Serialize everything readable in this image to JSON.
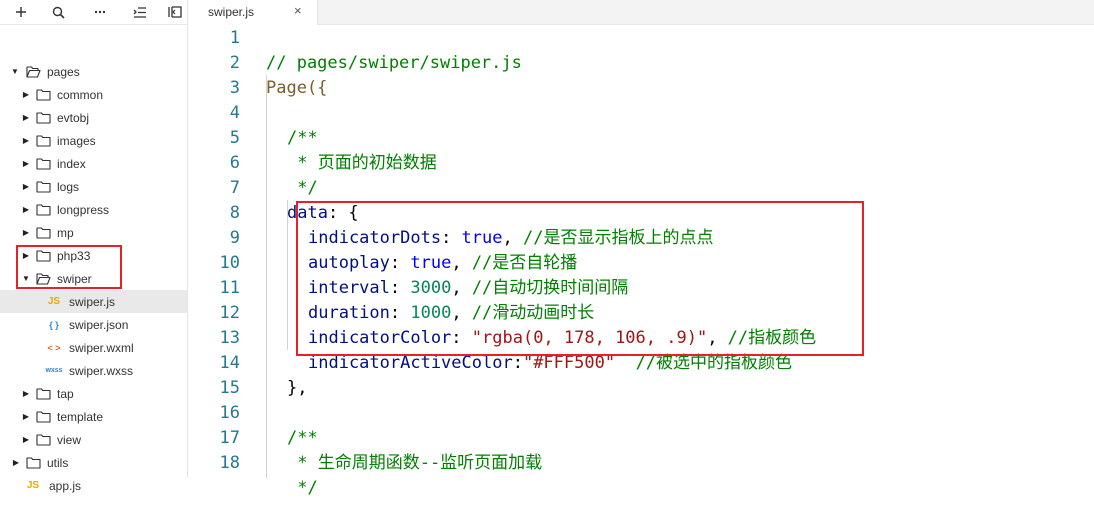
{
  "toolbar": {
    "add_icon": "plus-icon",
    "search_icon": "search-icon",
    "more_icon": "more-icon",
    "collapse_icon": "collapse-icon",
    "layout_icon": "layout-icon"
  },
  "tree": {
    "pages": "pages",
    "common": "common",
    "evtobj": "evtobj",
    "images": "images",
    "index": "index",
    "logs": "logs",
    "longpress": "longpress",
    "mp": "mp",
    "php33": "php33",
    "swiper": "swiper",
    "swiper_js": "swiper.js",
    "swiper_json": "swiper.json",
    "swiper_wxml": "swiper.wxml",
    "swiper_wxss": "swiper.wxss",
    "tap": "tap",
    "template": "template",
    "view": "view",
    "utils": "utils",
    "app_js": "app.js",
    "badges": {
      "js": "JS",
      "json": "{ }",
      "wxml": "< >",
      "wxss": "wxss"
    }
  },
  "tab": {
    "title": "swiper.js",
    "close": "×"
  },
  "code": {
    "line_numbers": [
      "1",
      "2",
      "3",
      "4",
      "5",
      "6",
      "7",
      "8",
      "9",
      "10",
      "11",
      "12",
      "13",
      "14",
      "15",
      "16",
      "17",
      "18"
    ],
    "l1": "// pages/swiper/swiper.js",
    "l2": "Page({",
    "l4": "/**",
    "l5": " * 页面的初始数据",
    "l6": " */",
    "l7a": "data",
    "l7b": ": {",
    "l8a": "indicatorDots",
    "l8b": ": ",
    "l8c": "true",
    "l8d": ", ",
    "l8e": "//是否显示指板上的点点",
    "l9a": "autoplay",
    "l9b": ": ",
    "l9c": "true",
    "l9d": ", ",
    "l9e": "//是否自轮播",
    "l10a": "interval",
    "l10b": ": ",
    "l10c": "3000",
    "l10d": ", ",
    "l10e": "//自动切换时间间隔",
    "l11a": "duration",
    "l11b": ": ",
    "l11c": "1000",
    "l11d": ", ",
    "l11e": "//滑动动画时长",
    "l12a": "indicatorColor",
    "l12b": ": ",
    "l12c": "\"rgba(0, 178, 106, .9)\"",
    "l12d": ", ",
    "l12e": "//指板颜色",
    "l13a": "indicatorActiveColor",
    "l13b": ":",
    "l13c": "\"#FFF500\"",
    "l13d": "  ",
    "l13e": "//被选中的指板颜色",
    "l14": "},",
    "l16": "/**",
    "l17": " * 生命周期函数--监听页面加载",
    "l18": " */"
  },
  "colors": {
    "highlight": "#e8202a",
    "comment": "#008000",
    "keyword": "#0000ff",
    "string": "#a31515",
    "number": "#098658"
  }
}
